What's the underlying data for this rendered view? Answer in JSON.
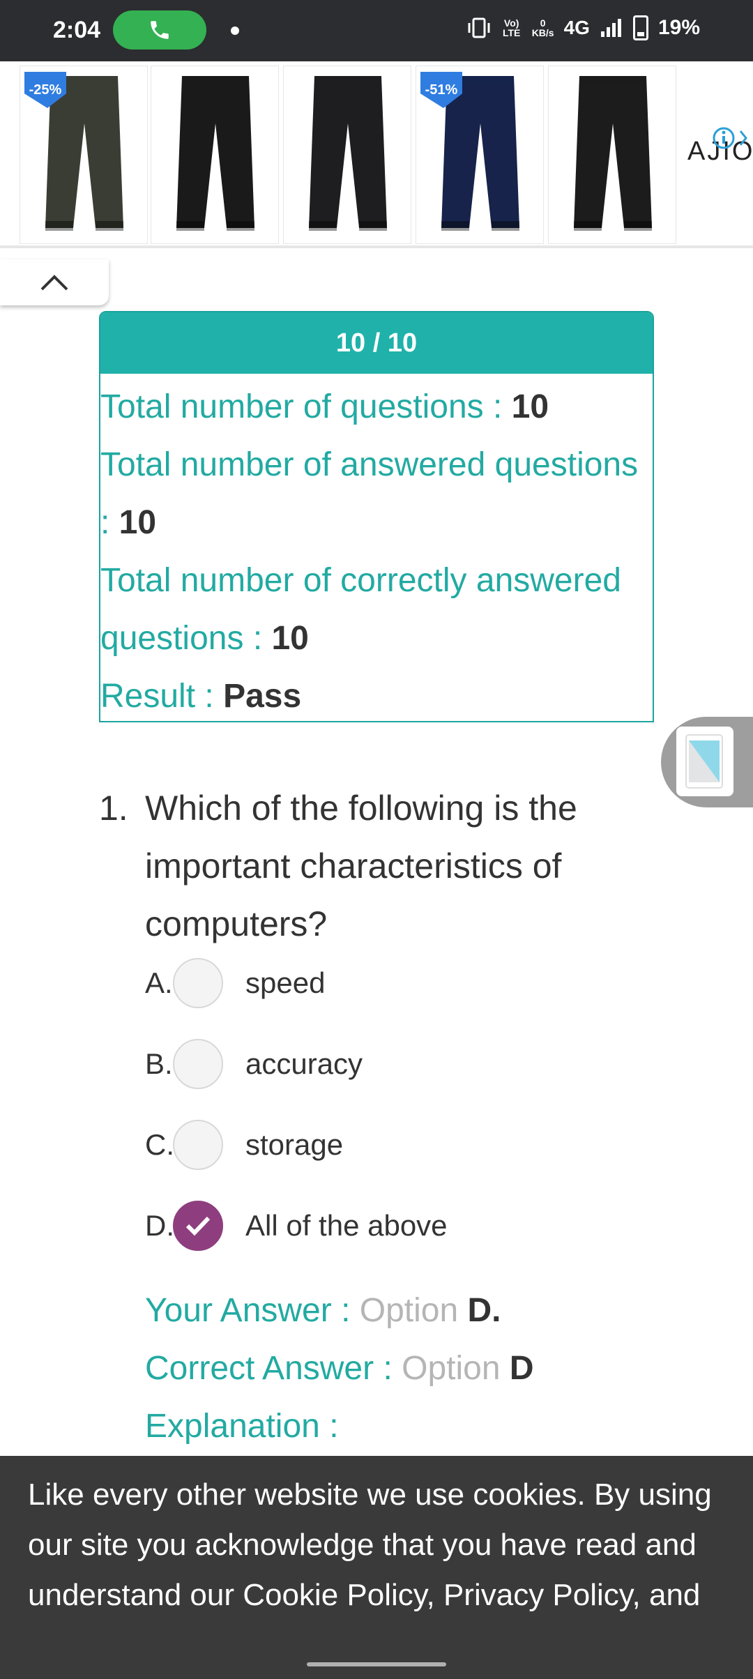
{
  "status_bar": {
    "time": "2:04",
    "network": "4G",
    "volte": "Vo) LTE",
    "data_rate_value": "0",
    "data_rate_unit": "KB/s",
    "battery": "19%"
  },
  "ad": {
    "items": [
      {
        "color": "#3a3d33",
        "discount": "-25%"
      },
      {
        "color": "#1a1a1a",
        "discount": ""
      },
      {
        "color": "#1e1e20",
        "discount": ""
      },
      {
        "color": "#17234a",
        "discount": "-51%"
      },
      {
        "color": "#1c1c1c",
        "discount": ""
      }
    ],
    "brand": "AJIO"
  },
  "result": {
    "score": "10 / 10",
    "rows": [
      {
        "label": "Total number of questions : ",
        "value": "10"
      },
      {
        "label": "Total number of answered questions : ",
        "value": "10"
      },
      {
        "label": "Total number of correctly answered questions : ",
        "value": "10"
      },
      {
        "label": "Result : ",
        "value": "Pass"
      }
    ]
  },
  "question": {
    "number": "1.",
    "text": "Which of the following is the important characteristics of computers?",
    "options": [
      {
        "letter": "A.",
        "text": "speed",
        "checked": false
      },
      {
        "letter": "B.",
        "text": "accuracy",
        "checked": false
      },
      {
        "letter": "C.",
        "text": "storage",
        "checked": false
      },
      {
        "letter": "D.",
        "text": "All of the above",
        "checked": true
      }
    ],
    "your_answer_label": "Your Answer : ",
    "your_answer_prefix": "Option ",
    "your_answer_value": "D.",
    "correct_answer_label": "Correct Answer : ",
    "correct_answer_prefix": "Option ",
    "correct_answer_value": "D",
    "explanation_label": "Explanation :"
  },
  "cookie": {
    "text": "Like every other website we use cookies. By using our site you acknowledge that you have read and understand our Cookie Policy, Privacy Policy, and our Terms of Service."
  }
}
